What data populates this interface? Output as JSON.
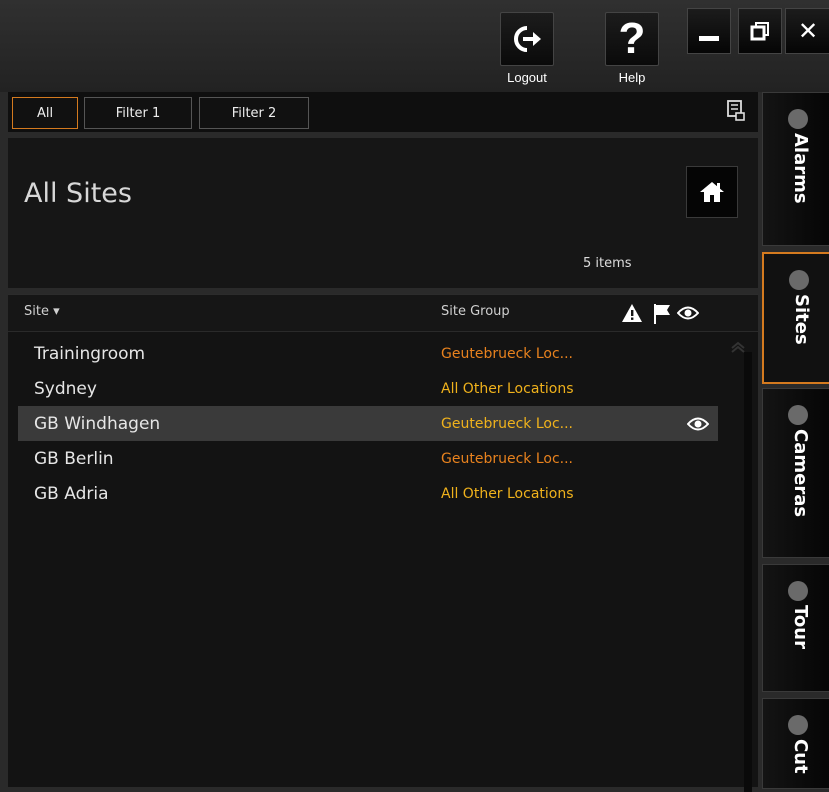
{
  "toolbar": {
    "logout_label": "Logout",
    "help_label": "Help"
  },
  "filters": {
    "all": "All",
    "filter1": "Filter 1",
    "filter2": "Filter 2"
  },
  "header": {
    "title": "All Sites",
    "item_count": "5 items"
  },
  "columns": {
    "site": "Site ▾",
    "site_group": "Site Group"
  },
  "rows": [
    {
      "site": "Trainingroom",
      "group": "Geutebrueck Loc..."
    },
    {
      "site": "Sydney",
      "group": "All Other Locations"
    },
    {
      "site": "GB Windhagen",
      "group": "Geutebrueck Loc..."
    },
    {
      "site": "GB Berlin",
      "group": "Geutebrueck Loc..."
    },
    {
      "site": "GB Adria",
      "group": "All Other Locations"
    }
  ],
  "tabs": {
    "alarms": "Alarms",
    "sites": "Sites",
    "cameras": "Cameras",
    "tour": "Tour",
    "cut": "Cut"
  },
  "colors": {
    "accent": "#d47a1f",
    "group_orange": "#e8821e",
    "group_yellow": "#f0b21c"
  }
}
